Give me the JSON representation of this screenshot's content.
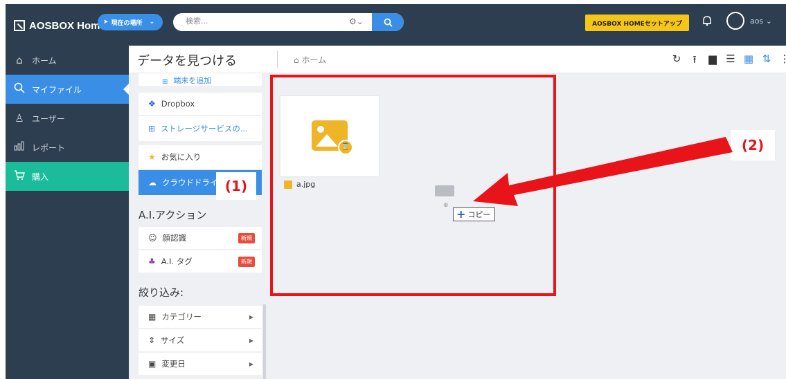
{
  "topbar": {
    "logo_text": "AOSBOX Home",
    "location_button": "現在の場所",
    "search_placeholder": "検索...",
    "setup_button": "AOSBOX HOMEセットアップ",
    "user_name": "aos"
  },
  "sidebar": {
    "items": [
      {
        "label": "ホーム",
        "icon": "home-icon"
      },
      {
        "label": "マイファイル",
        "icon": "search-icon"
      },
      {
        "label": "ユーザー",
        "icon": "users-icon"
      },
      {
        "label": "レポート",
        "icon": "chart-icon"
      },
      {
        "label": "購入",
        "icon": "cart-icon"
      }
    ]
  },
  "header": {
    "title": "データを見つける",
    "breadcrumb": "ホーム"
  },
  "left_panel": {
    "partial_top": "端末を追加",
    "dropbox": "Dropbox",
    "storage_service": "ストレージサービスの...",
    "favorites": "お気に入り",
    "cloud_drive": "クラウドドライ",
    "ai_section": "A.I.アクション",
    "face_recognition": "顔認識",
    "ai_tag": "A.I. タグ",
    "new_badge": "新規",
    "filter_section": "絞り込み:",
    "category": "カテゴリー",
    "size": "サイズ",
    "modified_date": "変更日"
  },
  "content": {
    "file_name": "a.jpg",
    "copy_tooltip": "コピー"
  },
  "annotations": {
    "label_1": "(1)",
    "label_2": "(2)",
    "color": "#e8141a"
  },
  "colors": {
    "sidebar_bg": "#2c3e50",
    "accent_blue": "#3a8ee6",
    "buy_green": "#1abc9c",
    "setup_yellow": "#f5c518"
  }
}
